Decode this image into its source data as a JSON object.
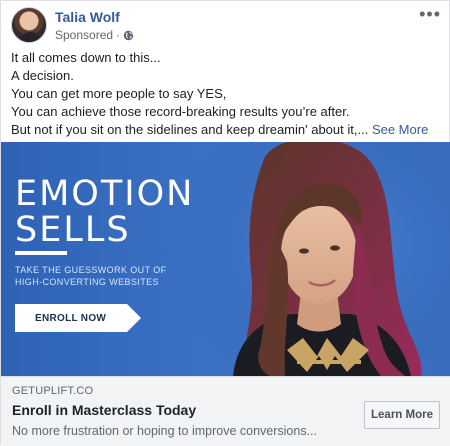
{
  "post": {
    "author": "Talia Wolf",
    "sponsored_label": "Sponsored",
    "separator": "·",
    "body_lines": [
      "It all comes down to this...",
      "A decision.",
      "You can get more people to say YES,",
      "You can achieve those record-breaking results you’re after.",
      "But not if you sit on the sidelines and keep dreamin' about it,..."
    ],
    "see_more": "See More"
  },
  "hero": {
    "title_line1": "EMOTION",
    "title_line2": "SELLS",
    "subtitle_line1": "TAKE THE GUESSWORK OUT OF",
    "subtitle_line2": "HIGH-CONVERTING WEBSITES",
    "cta": "ENROLL NOW"
  },
  "link": {
    "domain": "GETUPLIFT.CO",
    "headline": "Enroll in Masterclass Today",
    "description": "No more frustration or hoping to improve conversions...",
    "button": "Learn More"
  },
  "icons": {
    "globe": "globe-icon",
    "more": "more-options-icon"
  },
  "colors": {
    "link_blue": "#385898",
    "hero_blue": "#3b71c4"
  }
}
